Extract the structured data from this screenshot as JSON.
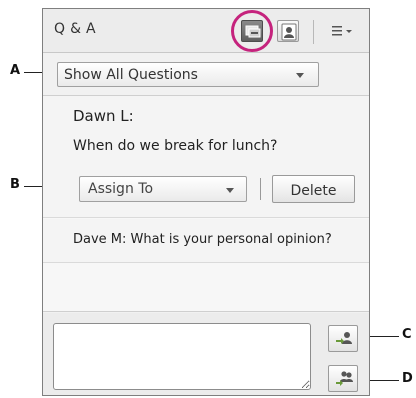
{
  "header": {
    "title": "Q & A",
    "icons": [
      "presenter-view-icon",
      "participant-view-icon",
      "panel-menu-icon"
    ]
  },
  "filter": {
    "selected": "Show All Questions"
  },
  "questions": [
    {
      "author": "Dawn  L:",
      "text": "When do we break for lunch?"
    },
    {
      "author": "Dave  M:",
      "text": "What is your personal opinion?"
    }
  ],
  "actions": {
    "assign_selected": "Assign To",
    "delete_label": "Delete"
  },
  "compose": {
    "value": ""
  },
  "callouts": {
    "a": "A",
    "b": "B",
    "c": "C",
    "d": "D"
  },
  "colors": {
    "highlight": "#c5237d",
    "active_icon": "#6e6e6e",
    "panel_bg": "#f1f1f1"
  }
}
